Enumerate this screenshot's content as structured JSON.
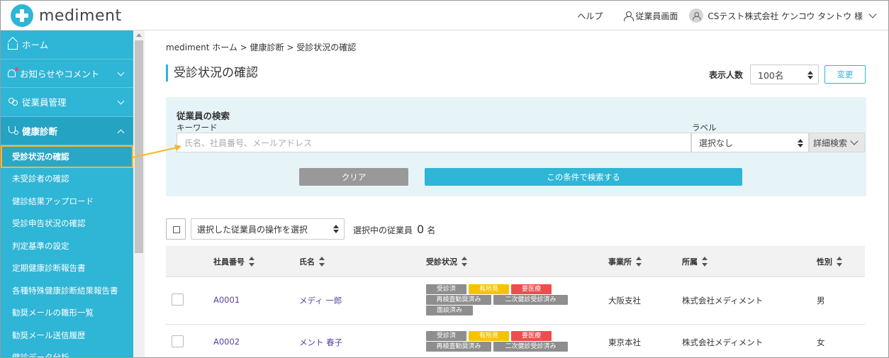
{
  "header": {
    "logo_text": "mediment",
    "help": "ヘルプ",
    "employee_screen": "従業員画面",
    "user_name": "CSテスト株式会社 ケンコウ タントウ 様"
  },
  "sidebar": {
    "items": [
      {
        "label": "ホーム",
        "icon": "home-icon"
      },
      {
        "label": "お知らせやコメント",
        "icon": "bell-icon"
      },
      {
        "label": "従業員管理",
        "icon": "people-icon"
      },
      {
        "label": "健康診断",
        "icon": "stethoscope-icon"
      }
    ],
    "sub_items": [
      "受診状況の確認",
      "未受診者の確認",
      "健診結果アップロード",
      "受診申告状況の確認",
      "判定基準の設定",
      "定期健康診断報告書",
      "各種特殊健康診断結果報告書",
      "勧奨メールの雛形一覧",
      "勧奨メール送信履歴",
      "健診データ分析"
    ],
    "active_sub": "受診状況の確認"
  },
  "main": {
    "breadcrumb": "mediment ホーム > 健康診断 > 受診状況の確認",
    "title": "受診状況の確認",
    "display_count_label": "表示人数",
    "display_count_value": "100名",
    "change_button": "変更",
    "search": {
      "title": "従業員の検索",
      "keyword_label": "キーワード",
      "keyword_placeholder": "氏名、社員番号、メールアドレス",
      "label_label": "ラベル",
      "label_value": "選択なし",
      "advanced_search": "詳細検索",
      "clear_button": "クリア",
      "search_button": "この条件で検索する"
    },
    "bulk": {
      "select_label": "選択した従業員の操作を選択",
      "selected_prefix": "選択中の従業員",
      "selected_count": "0",
      "selected_suffix": "名"
    },
    "table": {
      "columns": [
        "社員番号",
        "氏名",
        "受診状況",
        "事業所",
        "所属",
        "性別"
      ],
      "rows": [
        {
          "id": "A0001",
          "name": "メディ 一郎",
          "badges": [
            "受診済",
            "有所見",
            "要医療",
            "再検査勧奨済み",
            "二次健診受診済み",
            "面談済み"
          ],
          "office": "大阪支社",
          "dept": "株式会社メディメント",
          "gender": "男"
        },
        {
          "id": "A0002",
          "name": "メント 春子",
          "badges": [
            "受診済",
            "有所見",
            "要医療",
            "再検査勧奨済み",
            "二次健診受診済み"
          ],
          "office": "東京本社",
          "dept": "株式会社メディメント",
          "gender": "女"
        }
      ]
    }
  },
  "colors": {
    "accent": "#2fb5d6",
    "highlight_border": "#f7b829",
    "badge_gray": "#8e8e8e",
    "badge_yellow": "#f5c400",
    "badge_red": "#ef4d4d"
  }
}
